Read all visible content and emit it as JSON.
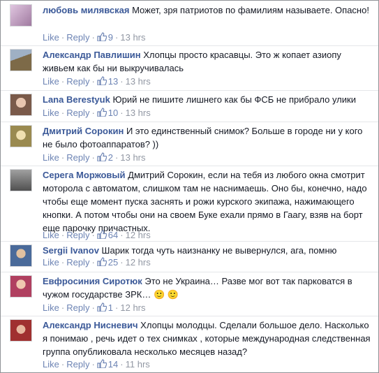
{
  "labels": {
    "like": "Like",
    "reply": "Reply"
  },
  "comments": [
    {
      "author": "любовь милявская",
      "text": "Может, зря патриотов по фамилиям называете. Опасно!",
      "likes": "9",
      "time": "13 hrs",
      "avatar_color": "#c9a7c9"
    },
    {
      "author": "Александр Павлишин",
      "text": "Хлопцы просто красавцы. Это ж копает азиопу живьем как бы ни выкручивалась",
      "likes": "13",
      "time": "13 hrs",
      "avatar_color": "#8c7a55"
    },
    {
      "author": "Lana Berestyuk",
      "text": "Юрий не пишите лишнего как бы ФСБ не прибрало улики",
      "likes": "10",
      "time": "13 hrs",
      "avatar_color": "#b08c78"
    },
    {
      "author": "Дмитрий Сорокин",
      "text": "И это единственный снимок? Больше в городе ни у кого не было фотоаппаратов? ))",
      "likes": "2",
      "time": "13 hrs",
      "avatar_color": "#b7a05c"
    },
    {
      "author": "Серега Моржовый",
      "text": "Дмитрий Сорокин, если на тебя из любого окна смотрит моторола с автоматом, слишком там не наснимаешь. Оно бы, конечно, надо чтобы еще момент пуска заснять и рожи курского экипажа, нажимающего кнопки. А потом чтобы они на своем Буке ехали прямо в Гаагу, взяв на борт еще парочку причастных.",
      "likes": "64",
      "time": "12 hrs",
      "avatar_color": "#6f6f6f"
    },
    {
      "author": "Sergii Ivanov",
      "text": "Шарик тогда чуть наизнанку не вывернулся, ага, помню",
      "likes": "25",
      "time": "12 hrs",
      "avatar_color": "#6b8ab0"
    },
    {
      "author": "Евфросиния Сиротюк",
      "text": "Это не Украина… Разве мог вот так парковатся в чужом государстве ЗРК…",
      "emoticons": "🙂 🙂",
      "likes": "1",
      "time": "12 hrs",
      "avatar_color": "#c45a7a"
    },
    {
      "author": "Александр Нисневич",
      "text": "Хлопцы молодцы. Сделали большое дело. Насколько я понимаю , речь идет о тех снимках , которые международная следственная группа опубликовала несколько месяцев назад?",
      "likes": "14",
      "time": "11 hrs",
      "avatar_color": "#c04040"
    }
  ]
}
